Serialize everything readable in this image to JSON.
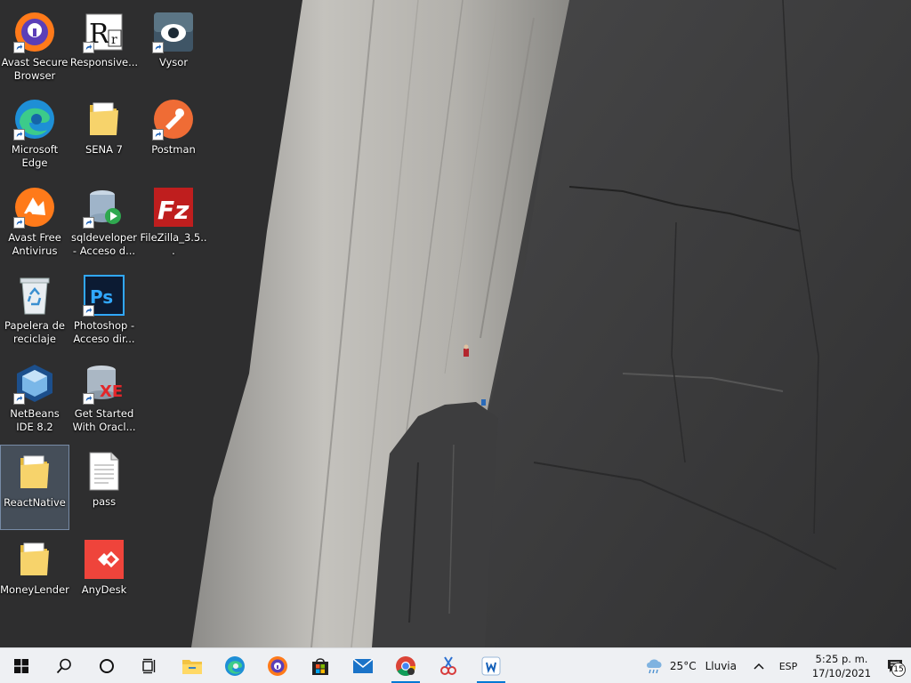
{
  "desktop": {
    "icons": [
      {
        "label": "Avast Secure Browser",
        "icon": "avast-browser-icon",
        "shortcut": true
      },
      {
        "label": "Responsive...",
        "icon": "responsive-icon",
        "shortcut": true
      },
      {
        "label": "Vysor",
        "icon": "vysor-icon",
        "shortcut": true
      },
      {
        "label": "Microsoft Edge",
        "icon": "edge-icon",
        "shortcut": true
      },
      {
        "label": "SENA 7",
        "icon": "folder-icon",
        "shortcut": false
      },
      {
        "label": "Postman",
        "icon": "postman-icon",
        "shortcut": true
      },
      {
        "label": "Avast Free Antivirus",
        "icon": "avast-antivirus-icon",
        "shortcut": true
      },
      {
        "label": "sqldeveloper - Acceso d...",
        "icon": "sqldeveloper-icon",
        "shortcut": true
      },
      {
        "label": "FileZilla_3.5...",
        "icon": "filezilla-icon",
        "shortcut": false
      },
      {
        "label": "Papelera de reciclaje",
        "icon": "recycle-bin-icon",
        "shortcut": false
      },
      {
        "label": "Photoshop - Acceso dir...",
        "icon": "photoshop-icon",
        "shortcut": true
      },
      {
        "label": "NetBeans IDE 8.2",
        "icon": "netbeans-icon",
        "shortcut": true
      },
      {
        "label": "Get Started With Oracl...",
        "icon": "oracle-xe-icon",
        "shortcut": true
      },
      {
        "label": "ReactNative",
        "icon": "folder-icon",
        "shortcut": false,
        "selected": true
      },
      {
        "label": "pass",
        "icon": "text-file-icon",
        "shortcut": false
      },
      {
        "label": "MoneyLender",
        "icon": "folder-icon",
        "shortcut": false
      },
      {
        "label": "AnyDesk",
        "icon": "anydesk-icon",
        "shortcut": false
      }
    ]
  },
  "taskbar": {
    "buttons": [
      {
        "name": "start-button",
        "icon": "windows-logo-icon"
      },
      {
        "name": "search-button",
        "icon": "search-icon"
      },
      {
        "name": "cortana-button",
        "icon": "cortana-circle-icon"
      },
      {
        "name": "task-view-button",
        "icon": "task-view-icon"
      },
      {
        "name": "file-explorer-button",
        "icon": "file-explorer-icon"
      },
      {
        "name": "edge-button",
        "icon": "edge-icon"
      },
      {
        "name": "avast-browser-button",
        "icon": "avast-browser-icon"
      },
      {
        "name": "store-button",
        "icon": "store-icon"
      },
      {
        "name": "mail-button",
        "icon": "mail-icon"
      },
      {
        "name": "chrome-button",
        "icon": "chrome-icon",
        "running": true
      },
      {
        "name": "snip-button",
        "icon": "snip-sketch-icon"
      },
      {
        "name": "app-button",
        "icon": "blue-app-icon",
        "running": true
      }
    ],
    "weather": {
      "temp": "25°C",
      "condition": "Lluvia",
      "icon": "rain-cloud-icon"
    },
    "language": "ESP",
    "clock": {
      "time": "5:25 p. m.",
      "date": "17/10/2021"
    },
    "notifications": {
      "count": "15"
    }
  },
  "colors": {
    "accent": "#0078d4",
    "taskbar_bg": "#eef0f3"
  }
}
